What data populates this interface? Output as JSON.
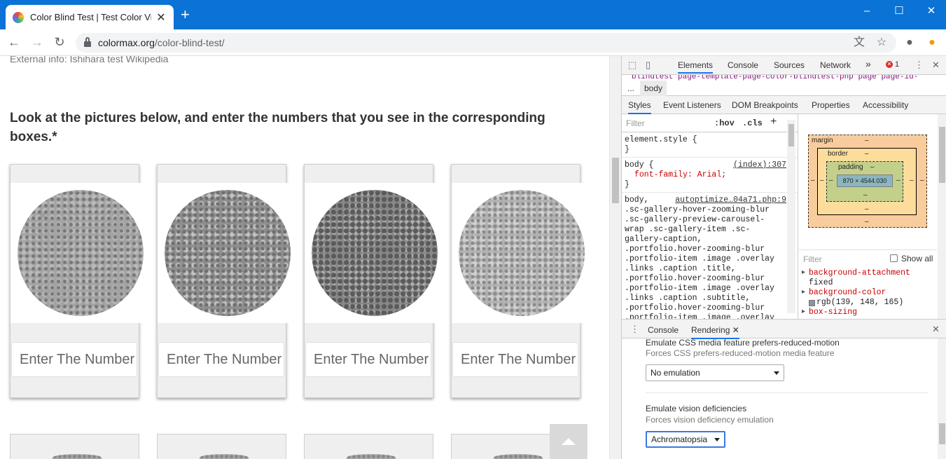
{
  "browser": {
    "tab_title": "Color Blind Test | Test Color Visi",
    "new_tab": "+",
    "close_tab": "✕",
    "url_host": "colormax.org",
    "url_path": "/color-blind-test/",
    "window_controls": {
      "minimize": "–",
      "maximize": "☐",
      "close": "✕"
    }
  },
  "page": {
    "external_info": "External info: Ishihara test Wikipedia",
    "heading": "Look at the pictures below, and enter the numbers that you see in the corresponding boxes.*",
    "input_placeholder": "Enter The Number",
    "cards": 4
  },
  "devtools": {
    "tabs": [
      "Elements",
      "Console",
      "Sources",
      "Network"
    ],
    "more": "»",
    "error_count": "1",
    "breadcrumb_more": "...",
    "breadcrumb_selected": "body",
    "breadcrumb_strip": "blindtest page-template-page-color-blindtest-php page page-id-",
    "subtabs": [
      "Styles",
      "Event Listeners",
      "DOM Breakpoints",
      "Properties",
      "Accessibility"
    ],
    "filter_placeholder": "Filter",
    "hov": ":hov",
    "cls": ".cls",
    "plus": "+",
    "rules": {
      "element_style": "element.style {",
      "close_brace": "}",
      "body_selector": "body {",
      "body_source": "(index):307",
      "body_prop": "font-family: Arial;",
      "long_source": "autoptimize…04a71.php:9",
      "long_selector_lines": [
        "body,",
        ".sc-gallery-hover-zooming-blur",
        ".sc-gallery-preview-carousel-",
        "wrap .sc-gallery-item .sc-",
        "gallery-caption,",
        ".portfolio.hover-zooming-blur",
        ".portfolio-item .image .overlay",
        ".links .caption .title,",
        ".portfolio.hover-zooming-blur",
        ".portfolio-item .image .overlay",
        ".links .caption .subtitle,",
        ".portfolio.hover-zooming-blur",
        ".portfolio-item .image .overlay"
      ]
    },
    "box_model": {
      "margin_label": "margin",
      "border_label": "border",
      "padding_label": "padding",
      "dash": "–",
      "content_size": "870 × 4544.030"
    },
    "computed": {
      "filter_placeholder": "Filter",
      "show_all": "Show all",
      "props": [
        {
          "name": "background-attachment",
          "value": "fixed"
        },
        {
          "name": "background-color",
          "value": "rgb(139, 148, 165)"
        },
        {
          "name": "box-sizing",
          "value": ""
        }
      ]
    },
    "drawer": {
      "tabs": [
        "Console",
        "Rendering"
      ],
      "close": "✕",
      "motion_title": "Emulate CSS media feature prefers-reduced-motion",
      "motion_desc": "Forces CSS prefers-reduced-motion media feature",
      "motion_value": "No emulation",
      "vision_title": "Emulate vision deficiencies",
      "vision_desc": "Forces vision deficiency emulation",
      "vision_value": "Achromatopsia"
    }
  }
}
